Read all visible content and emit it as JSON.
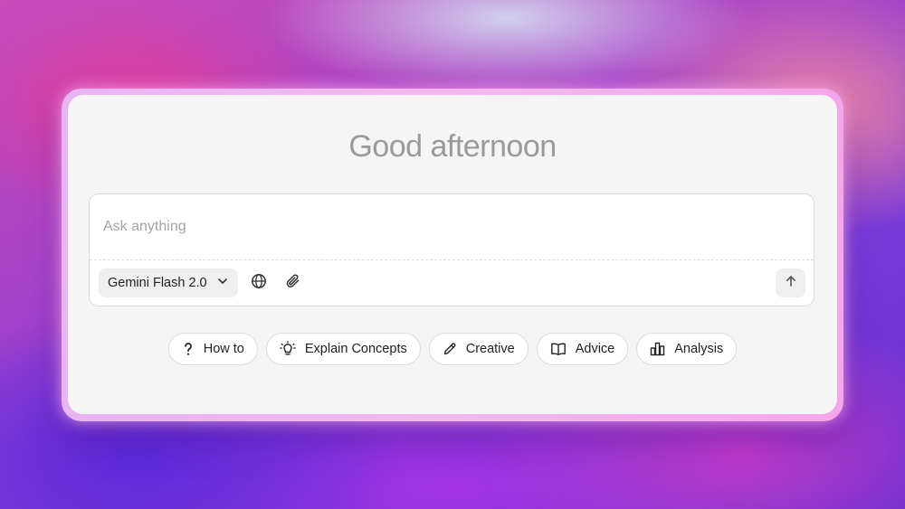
{
  "greeting": "Good afternoon",
  "composer": {
    "placeholder": "Ask anything",
    "value": "",
    "model": "Gemini Flash 2.0"
  },
  "icons": {
    "model_dropdown": "chevron-down-icon",
    "web_search": "globe-icon",
    "attach": "paperclip-icon",
    "send": "arrow-up-icon"
  },
  "suggestions": [
    {
      "label": "How to",
      "icon": "question-mark-icon"
    },
    {
      "label": "Explain Concepts",
      "icon": "lightbulb-icon"
    },
    {
      "label": "Creative",
      "icon": "pencil-icon"
    },
    {
      "label": "Advice",
      "icon": "book-icon"
    },
    {
      "label": "Analysis",
      "icon": "bar-chart-icon"
    }
  ],
  "colors": {
    "card_background": "#f5f5f5",
    "card_glow": "#f2b8ee",
    "greeting_text": "#9a9a9a"
  }
}
